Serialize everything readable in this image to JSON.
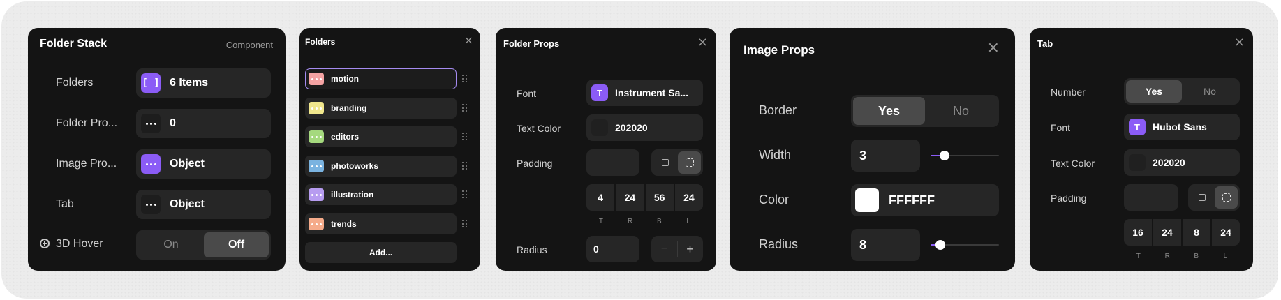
{
  "panel1": {
    "title": "Folder Stack",
    "tag": "Component",
    "rows": [
      {
        "label": "Folders",
        "value": "6 Items",
        "icon": "brackets-icon",
        "value_icon": "[ ]"
      },
      {
        "label": "Folder Pro...",
        "value": "0",
        "icon": "more-icon"
      },
      {
        "label": "Image Pro...",
        "value": "Object",
        "icon": "more-icon"
      },
      {
        "label": "Tab",
        "value": "Object",
        "icon": "more-icon"
      }
    ],
    "hover": {
      "label": "3D Hover",
      "on": "On",
      "off": "Off",
      "selected": "Off"
    }
  },
  "panel2": {
    "title": "Folders",
    "close": "×",
    "folders": [
      {
        "name": "motion",
        "color": "#f4a3a3"
      },
      {
        "name": "branding",
        "color": "#f0e68c"
      },
      {
        "name": "editors",
        "color": "#a5d97e"
      },
      {
        "name": "photoworks",
        "color": "#7ab3e0"
      },
      {
        "name": "illustration",
        "color": "#b79cf0"
      },
      {
        "name": "trends",
        "color": "#f5ab8a"
      }
    ],
    "add": "Add..."
  },
  "panel3": {
    "title": "Folder Props",
    "close": "×",
    "font_label": "Font",
    "font_value": "Instrument Sa...",
    "font_icon": "T",
    "text_color_label": "Text Color",
    "text_color_value": "202020",
    "padding_label": "Padding",
    "padding_values": [
      "4",
      "24",
      "56",
      "24"
    ],
    "padding_letters": [
      "T",
      "R",
      "B",
      "L"
    ],
    "radius_label": "Radius",
    "radius_value": "0",
    "minus": "−",
    "plus": "+"
  },
  "panel4": {
    "title": "Image Props",
    "close": "×",
    "border_label": "Border",
    "border_yes": "Yes",
    "border_no": "No",
    "border_selected": "Yes",
    "width_label": "Width",
    "width_value": "3",
    "width_slider_fraction": 0.2,
    "color_label": "Color",
    "color_value": "FFFFFF",
    "radius_label": "Radius",
    "radius_value": "8",
    "radius_slider_fraction": 0.14
  },
  "panel5": {
    "title": "Tab",
    "close": "×",
    "number_label": "Number",
    "number_yes": "Yes",
    "number_no": "No",
    "number_selected": "Yes",
    "font_label": "Font",
    "font_value": "Hubot Sans",
    "font_icon": "T",
    "text_color_label": "Text Color",
    "text_color_value": "202020",
    "padding_label": "Padding",
    "padding_values": [
      "16",
      "24",
      "8",
      "24"
    ],
    "padding_letters": [
      "T",
      "R",
      "B",
      "L"
    ]
  },
  "colors": {
    "accent": "#8b5cf6",
    "panel": "#141414",
    "field": "#262626",
    "white_swatch": "#ffffff",
    "dark_swatch": "#202020"
  }
}
